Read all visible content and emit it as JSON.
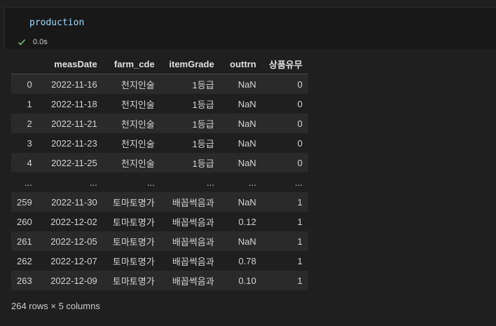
{
  "code_cell": {
    "code": "production",
    "status_icon": "check-icon",
    "exec_time": "0.0s",
    "success_color": "#89d185"
  },
  "dataframe": {
    "columns": [
      "",
      "measDate",
      "farm_cde",
      "itemGrade",
      "outtrn",
      "상품유무"
    ],
    "rows": [
      [
        "0",
        "2022-11-16",
        "천지인술",
        "1등급",
        "NaN",
        "0"
      ],
      [
        "1",
        "2022-11-18",
        "천지인술",
        "1등급",
        "NaN",
        "0"
      ],
      [
        "2",
        "2022-11-21",
        "천지인술",
        "1등급",
        "NaN",
        "0"
      ],
      [
        "3",
        "2022-11-23",
        "천지인술",
        "1등급",
        "NaN",
        "0"
      ],
      [
        "4",
        "2022-11-25",
        "천지인술",
        "1등급",
        "NaN",
        "0"
      ],
      [
        "...",
        "...",
        "...",
        "...",
        "...",
        "..."
      ],
      [
        "259",
        "2022-11-30",
        "토마토명가",
        "배꼽썩음과",
        "NaN",
        "1"
      ],
      [
        "260",
        "2022-12-02",
        "토마토명가",
        "배꼽썩음과",
        "0.12",
        "1"
      ],
      [
        "261",
        "2022-12-05",
        "토마토명가",
        "배꼽썩음과",
        "NaN",
        "1"
      ],
      [
        "262",
        "2022-12-07",
        "토마토명가",
        "배꼽썩음과",
        "0.78",
        "1"
      ],
      [
        "263",
        "2022-12-09",
        "토마토명가",
        "배꼽썩음과",
        "0.10",
        "1"
      ]
    ],
    "shape_text": "264 rows × 5 columns"
  }
}
